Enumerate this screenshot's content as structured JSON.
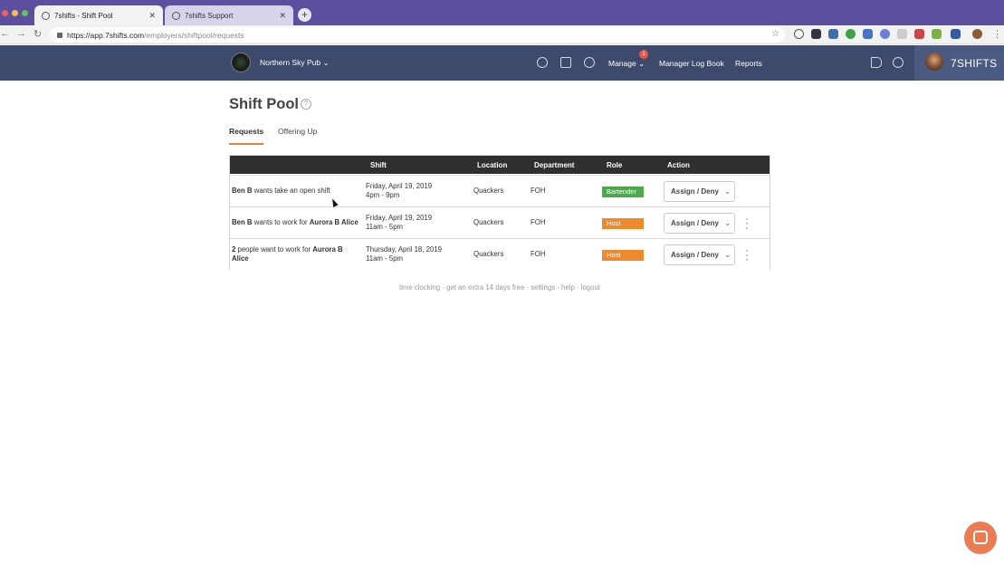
{
  "browser": {
    "tabs": [
      {
        "title": "7shifts - Shift Pool",
        "active": true
      },
      {
        "title": "7shifts Support",
        "active": false
      }
    ],
    "url_host": "https://app.7shifts.com",
    "url_path": "/employers/shiftpool/requests"
  },
  "header": {
    "location": "Northern Sky Pub",
    "nav": {
      "manage": "Manage",
      "manager_log_book": "Manager Log Book",
      "reports": "Reports"
    },
    "manage_badge": "1",
    "brand": "7SHIFTS"
  },
  "page": {
    "title": "Shift Pool",
    "help": "?",
    "tabs": [
      "Requests",
      "Offering Up"
    ]
  },
  "table": {
    "headers": {
      "shift": "Shift",
      "location": "Location",
      "department": "Department",
      "role": "Role",
      "action": "Action"
    },
    "rows": [
      {
        "who_bold": "Ben B",
        "who_text": " wants take an open shift",
        "who_target": "",
        "shift_date": "Friday, April 19, 2019",
        "shift_time": "4pm - 9pm",
        "location": "Quackers",
        "department": "FOH",
        "role": "Bartender",
        "action": "Assign / Deny"
      },
      {
        "who_bold": "Ben B",
        "who_text": " wants to work for ",
        "who_target": "Aurora B Alice",
        "shift_date": "Friday, April 19, 2019",
        "shift_time": "11am - 5pm",
        "location": "Quackers",
        "department": "FOH",
        "role": "Host",
        "action": "Assign / Deny"
      },
      {
        "who_bold": "2",
        "who_text": " people want to work for ",
        "who_target": "Aurora B Alice",
        "shift_date": "Thursday, April 18, 2019",
        "shift_time": "11am - 5pm",
        "location": "Quackers",
        "department": "FOH",
        "role": "Host",
        "action": "Assign / Deny"
      }
    ]
  },
  "footer": {
    "links": [
      "time clocking",
      "get an extra 14 days free",
      "settings",
      "help",
      "logout"
    ],
    "separator": " · "
  },
  "colors": {
    "header_bg": "#3d4a6b",
    "tab_accent": "#e8813b",
    "role_bartender": "#4ca94d",
    "role_host": "#ef8a2c",
    "chat": "#ea7b53"
  }
}
